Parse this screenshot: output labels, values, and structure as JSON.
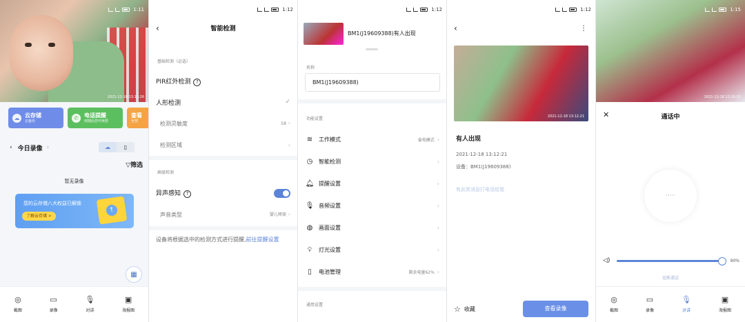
{
  "panel1": {
    "status_time": "1:11",
    "video_timestamp": "2021-12-18  13:11:26",
    "cards": [
      {
        "title": "云存储",
        "subtitle": "云备份"
      },
      {
        "title": "电话提醒",
        "subtitle": "到期后您可续费"
      },
      {
        "title": "查看",
        "subtitle": "全部"
      }
    ],
    "recordings_title": "今日录像",
    "filter_label": "筛选",
    "no_recordings": "暂无录像",
    "banner_text": "您的云存储八大权益已解锁",
    "banner_button": "了解云存储 >",
    "nav": [
      "截图",
      "录像",
      "对讲",
      "海报图"
    ]
  },
  "panel2": {
    "status_time": "1:12",
    "title": "智能检测",
    "section_basic": "基础检测（必选）",
    "pir_label": "PIR红外检测",
    "human_label": "人形检测",
    "sensitivity_label": "检测灵敏度",
    "sensitivity_value": "58",
    "area_label": "检测区域",
    "section_advanced": "高级检测",
    "sound_label": "异声感知",
    "sound_type_label": "声音类型",
    "sound_type_value": "婴儿啼哭",
    "note_text": "设备将根据选中的检测方式进行提醒,",
    "note_link": "前往提醒设置"
  },
  "panel3": {
    "status_time": "1:12",
    "notification_title": "BM1(J19609388)有人出现",
    "name_label": "名称",
    "name_value": "BM1(J19609388)",
    "section_features": "功能设置",
    "menu": [
      {
        "icon": "layers-icon",
        "label": "工作模式",
        "value": "省电模式"
      },
      {
        "icon": "clock-icon",
        "label": "智能检测",
        "value": ""
      },
      {
        "icon": "bell-icon",
        "label": "提醒设置",
        "value": ""
      },
      {
        "icon": "mic-icon",
        "label": "音频设置",
        "value": ""
      },
      {
        "icon": "palette-icon",
        "label": "画面设置",
        "value": ""
      },
      {
        "icon": "bulb-icon",
        "label": "灯光设置",
        "value": ""
      },
      {
        "icon": "battery-icon",
        "label": "电池管理",
        "value": "剩余电量62%"
      }
    ],
    "section_general": "通用设置"
  },
  "panel4": {
    "status_time": "1:12",
    "video_timestamp": "2021-12-18  13:12:21",
    "event_title": "有人出现",
    "event_time": "2021-12-18 13:12:21",
    "device_text": "设备：BM1(J19609388)",
    "link_text": "有此类消息打电话给我",
    "favorite_label": "收藏",
    "view_button": "查看录像"
  },
  "panel5": {
    "status_time": "1:15",
    "video_timestamp": "2021-12-18  13:15:01",
    "title": "通话中",
    "volume_value": "90%",
    "hangup_label": "挂断通话",
    "nav": [
      "截图",
      "录像",
      "对讲",
      "海报图"
    ]
  }
}
